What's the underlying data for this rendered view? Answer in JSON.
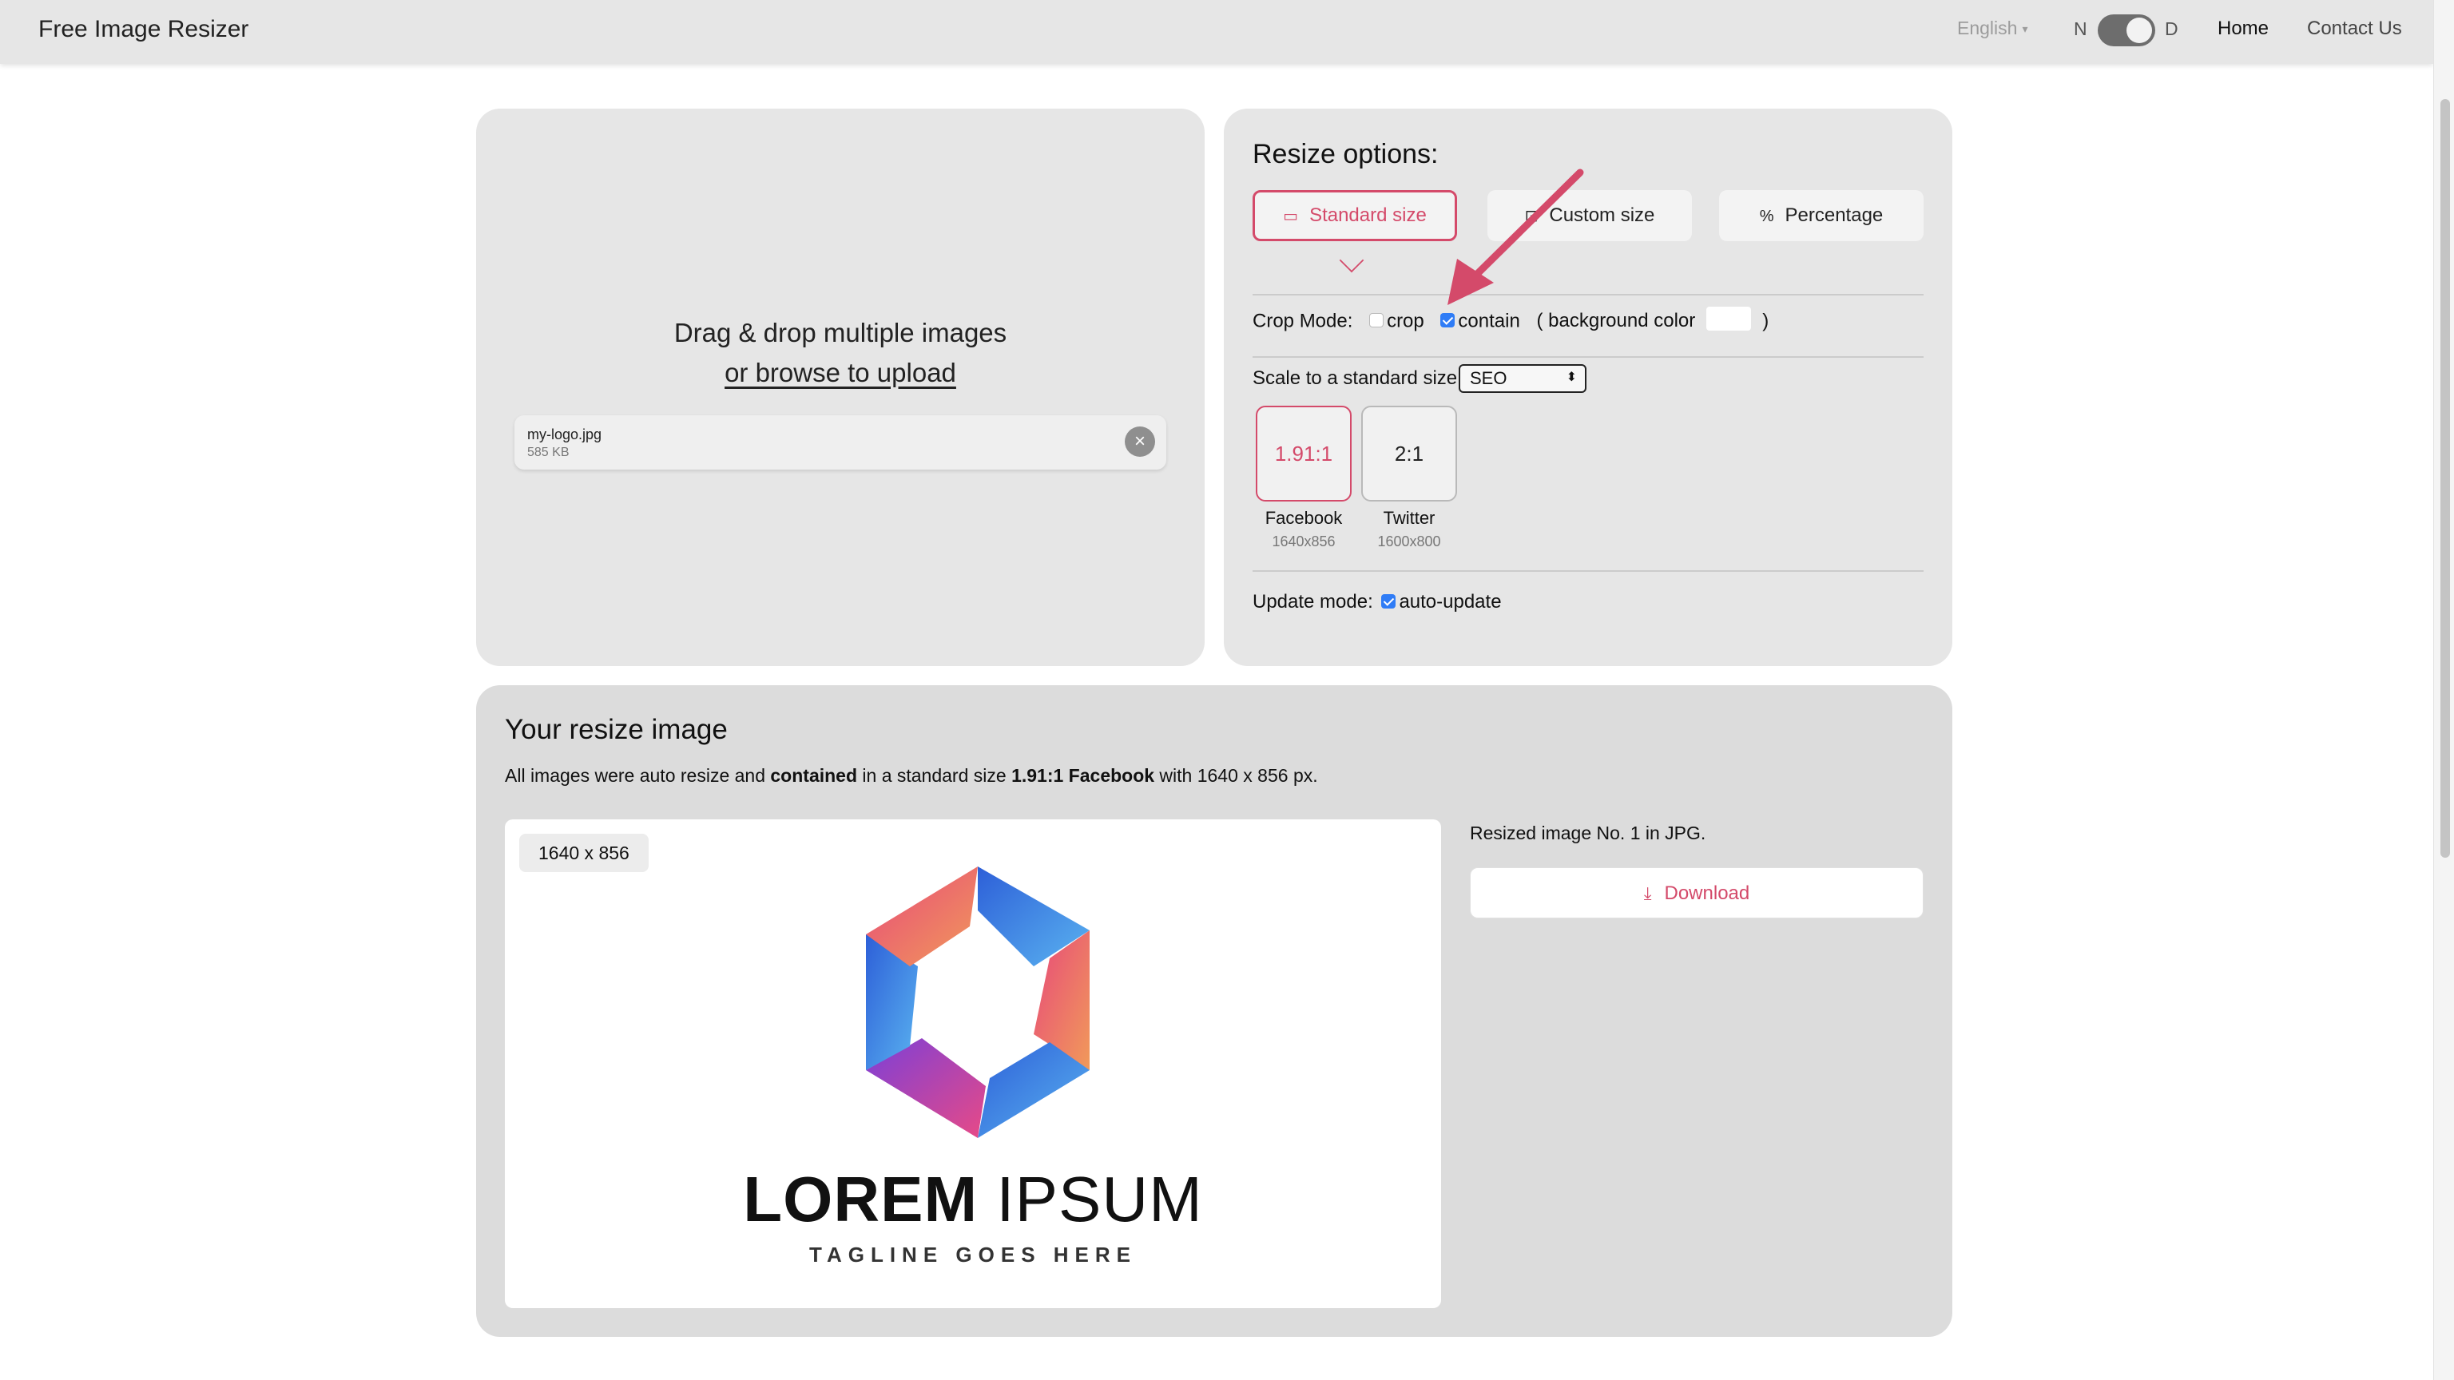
{
  "navbar": {
    "brand": "Free Image Resizer",
    "language": "English",
    "theme_left": "N",
    "theme_right": "D",
    "home": "Home",
    "contact": "Contact Us"
  },
  "upload": {
    "drop_line1": "Drag & drop multiple images",
    "drop_line2": "or browse to upload",
    "file": {
      "name": "my-logo.jpg",
      "size": "585 KB"
    }
  },
  "options": {
    "title": "Resize options:",
    "tabs": [
      {
        "label": "Standard size",
        "icon": "sd-icon",
        "active": true
      },
      {
        "label": "Custom size",
        "icon": "crop-icon",
        "active": false
      },
      {
        "label": "Percentage",
        "icon": "percent-icon",
        "active": false
      }
    ],
    "crop_mode": {
      "label": "Crop Mode:",
      "crop": "crop",
      "contain": "contain",
      "bg_open": "( background color",
      "bg_close": ")",
      "crop_checked": false,
      "contain_checked": true,
      "bg_color": "#ffffff"
    },
    "scale": {
      "label": "Scale to a standard size",
      "selected": "SEO"
    },
    "ratios": [
      {
        "ratio": "1.91:1",
        "name": "Facebook",
        "dims": "1640x856",
        "selected": true
      },
      {
        "ratio": "2:1",
        "name": "Twitter",
        "dims": "1600x800",
        "selected": false
      }
    ],
    "update_mode": {
      "label": "Update mode:",
      "auto": "auto-update",
      "checked": true
    }
  },
  "result": {
    "title": "Your resize image",
    "desc_part1": "All images were auto resize and ",
    "desc_bold1": "contained",
    "desc_part2": " in a standard size ",
    "desc_bold2": "1.91:1 Facebook",
    "desc_part3": " with 1640 x 856 px.",
    "size_badge": "1640 x 856",
    "logo_word1": "LOREM",
    "logo_word2": " IPSUM",
    "logo_tagline": "TAGLINE GOES HERE",
    "info": "Resized image No. 1 in JPG.",
    "download": "Download"
  },
  "colors": {
    "accent": "#d44a6a",
    "checkbox": "#2f7cf6",
    "panel": "#e6e6e6"
  }
}
